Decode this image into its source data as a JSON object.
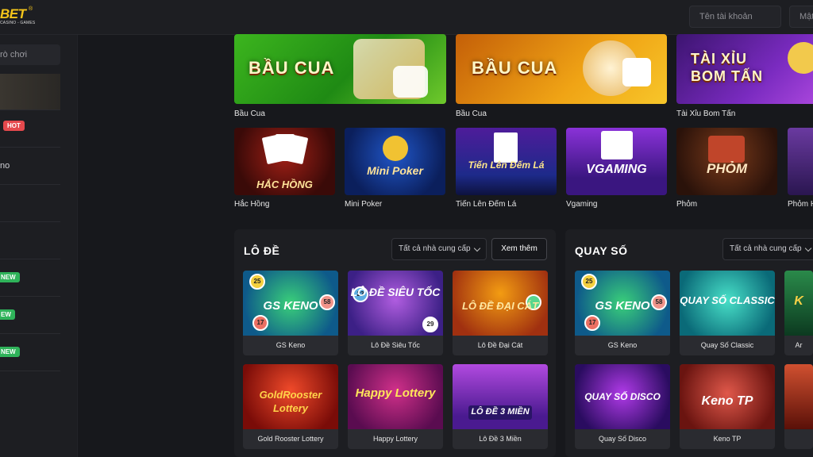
{
  "header": {
    "logo_text": "BET",
    "logo_reg": "®",
    "logo_sub": "CASINO - GAMES",
    "account_placeholder": "Tên tài khoản",
    "password_placeholder": "Mật khẩu"
  },
  "sidebar": {
    "search_text": "rò chơi",
    "items": [
      {
        "label": "",
        "badge": ""
      },
      {
        "label": "",
        "badge": "HOT"
      },
      {
        "label": "no",
        "badge": ""
      },
      {
        "label": "",
        "badge": ""
      },
      {
        "label": "",
        "badge": ""
      },
      {
        "label": "",
        "badge": "NEW"
      },
      {
        "label": "",
        "badge": "EW"
      },
      {
        "label": "",
        "badge": "NEW"
      }
    ]
  },
  "top_banners": [
    {
      "art": "BẦU CUA",
      "caption": "Bầu Cua",
      "bg": "#2e9e1c"
    },
    {
      "art": "BẦU CUA",
      "caption": "Bầu Cua",
      "bg": "#e08a10"
    },
    {
      "art": "TÀI XỈU BOM TẤN",
      "caption": "Tài Xỉu Bom Tấn",
      "bg": "#6a22a8"
    }
  ],
  "games_row": [
    {
      "art": "HẮC HỒNG",
      "caption": "Hắc Hồng"
    },
    {
      "art": "Mini Poker",
      "caption": "Mini Poker"
    },
    {
      "art": "Tiến Lên Đếm Lá",
      "caption": "Tiến Lên Đếm Lá"
    },
    {
      "art": "VGAMING",
      "caption": "Vgaming"
    },
    {
      "art": "PHỎM",
      "caption": "Phỏm"
    },
    {
      "art": "",
      "caption": "Phỏm H"
    }
  ],
  "lo_de": {
    "title": "LÔ ĐỀ",
    "provider_label": "Tất cả nhà cung cấp",
    "more_label": "Xem thêm",
    "cards": [
      {
        "art": "GS KENO",
        "label": "GS Keno"
      },
      {
        "art": "LÔ ĐỀ SIÊU TỐC",
        "label": "Lô Đề Siêu Tốc"
      },
      {
        "art": "LÔ ĐỀ ĐẠI CÁT",
        "label": "Lô Đề Đại Cát"
      },
      {
        "art": "GoldRooster Lottery",
        "label": "Gold Rooster Lottery"
      },
      {
        "art": "Happy Lottery",
        "label": "Happy Lottery"
      },
      {
        "art": "LÔ ĐỀ 3 MIỀN",
        "label": "Lô Đề 3 Miền"
      }
    ]
  },
  "quay_so": {
    "title": "QUAY SỐ",
    "provider_label": "Tất cả nhà cung cấp",
    "cards": [
      {
        "art": "GS KENO",
        "label": "GS Keno"
      },
      {
        "art": "QUAY SỐ CLASSIC",
        "label": "Quay Số Classic"
      },
      {
        "art": "K",
        "label": "Ar"
      },
      {
        "art": "QUAY SỐ DISCO",
        "label": "Quay Số Disco"
      },
      {
        "art": "Keno TP",
        "label": "Keno TP"
      },
      {
        "art": "",
        "label": ""
      }
    ]
  }
}
